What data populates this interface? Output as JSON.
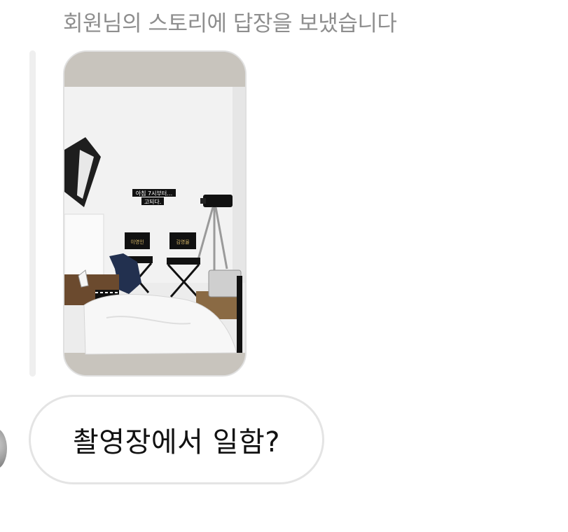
{
  "header": {
    "reply_text": "회원님의 스토리에 답장을 보냈습니다"
  },
  "story": {
    "overlay_line1": "아침 7시부터…",
    "overlay_line2": "고되다.",
    "chair_left_name": "이영인",
    "chair_right_name": "김영율"
  },
  "message": {
    "text": "촬영장에서 일함?"
  },
  "colors": {
    "header_text": "#8e8e8e",
    "bubble_border": "#e4e4e4",
    "message_text": "#111111"
  }
}
